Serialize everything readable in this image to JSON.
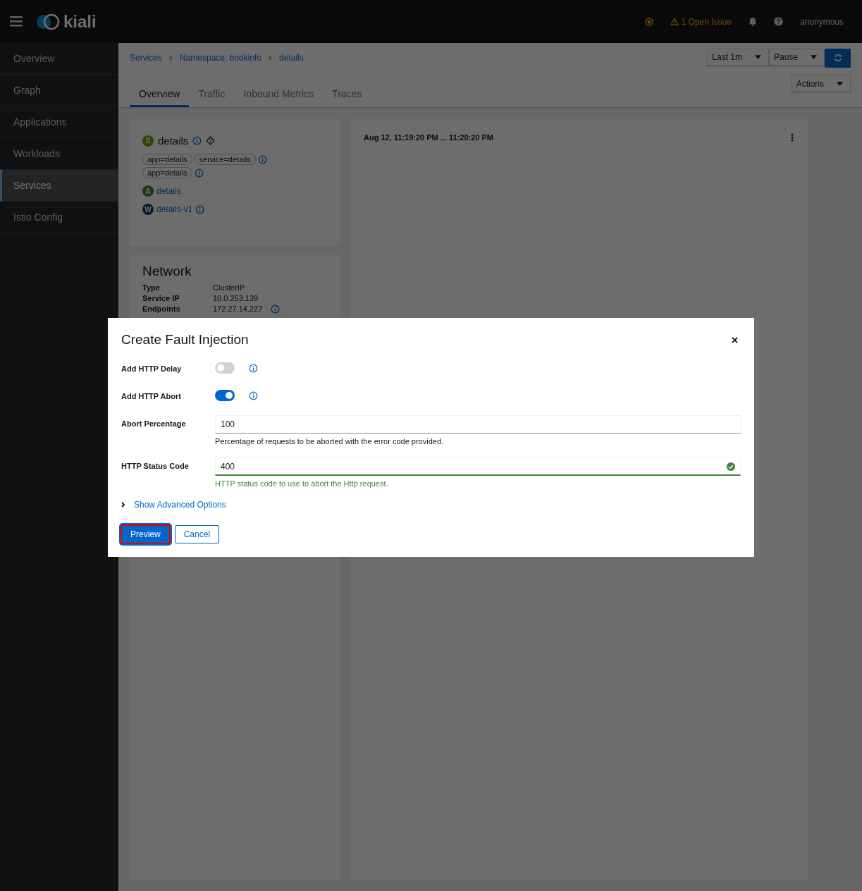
{
  "header": {
    "brand": "kiali",
    "issues": "1 Open Issue",
    "user": "anonymous"
  },
  "sidebar": {
    "items": [
      {
        "label": "Overview",
        "selected": false
      },
      {
        "label": "Graph",
        "selected": false
      },
      {
        "label": "Applications",
        "selected": false
      },
      {
        "label": "Workloads",
        "selected": false
      },
      {
        "label": "Services",
        "selected": true
      },
      {
        "label": "Istio Config",
        "selected": false
      }
    ]
  },
  "breadcrumb": [
    "Services",
    "Namespace: bookinfo",
    "details"
  ],
  "toolbar": {
    "duration": "Last 1m",
    "refresh": "Pause",
    "actions": "Actions"
  },
  "tabs": [
    {
      "label": "Overview",
      "selected": true
    },
    {
      "label": "Traffic",
      "selected": false
    },
    {
      "label": "Inbound Metrics",
      "selected": false
    },
    {
      "label": "Traces",
      "selected": false
    }
  ],
  "service_card": {
    "badge": "S",
    "kind": "service",
    "name": "details",
    "labels": [
      "app=details",
      "service=details"
    ],
    "selector_labels": [
      "app=details"
    ],
    "links": [
      {
        "badge": "A",
        "kind": "app",
        "name": "details",
        "info": false
      },
      {
        "badge": "W",
        "kind": "workload",
        "name": "details-v1",
        "info": true
      }
    ]
  },
  "network": {
    "title": "Network",
    "rows": [
      {
        "label": "Type",
        "value": "ClusterIP",
        "info": false
      },
      {
        "label": "Service IP",
        "value": "10.0.253.139",
        "info": false
      },
      {
        "label": "Endpoints",
        "value": "172.27.14.227",
        "info": true
      }
    ]
  },
  "traffic_panel": {
    "time_range": "Aug 12, 11:19:20 PM ... 11:20:20 PM"
  },
  "modal": {
    "title": "Create Fault Injection",
    "toggles": [
      {
        "label": "Add HTTP Delay",
        "on": false
      },
      {
        "label": "Add HTTP Abort",
        "on": true
      }
    ],
    "fields": [
      {
        "label": "Abort Percentage",
        "value": "100",
        "helper": "Percentage of requests to be aborted with the error code provided.",
        "valid": false
      },
      {
        "label": "HTTP Status Code",
        "value": "400",
        "helper": "HTTP status code to use to abort the Http request.",
        "valid": true
      }
    ],
    "advanced": "Show Advanced Options",
    "buttons": [
      {
        "label": "Preview",
        "kind": "primary",
        "focused": true
      },
      {
        "label": "Cancel",
        "kind": "secondary",
        "focused": false
      }
    ]
  }
}
